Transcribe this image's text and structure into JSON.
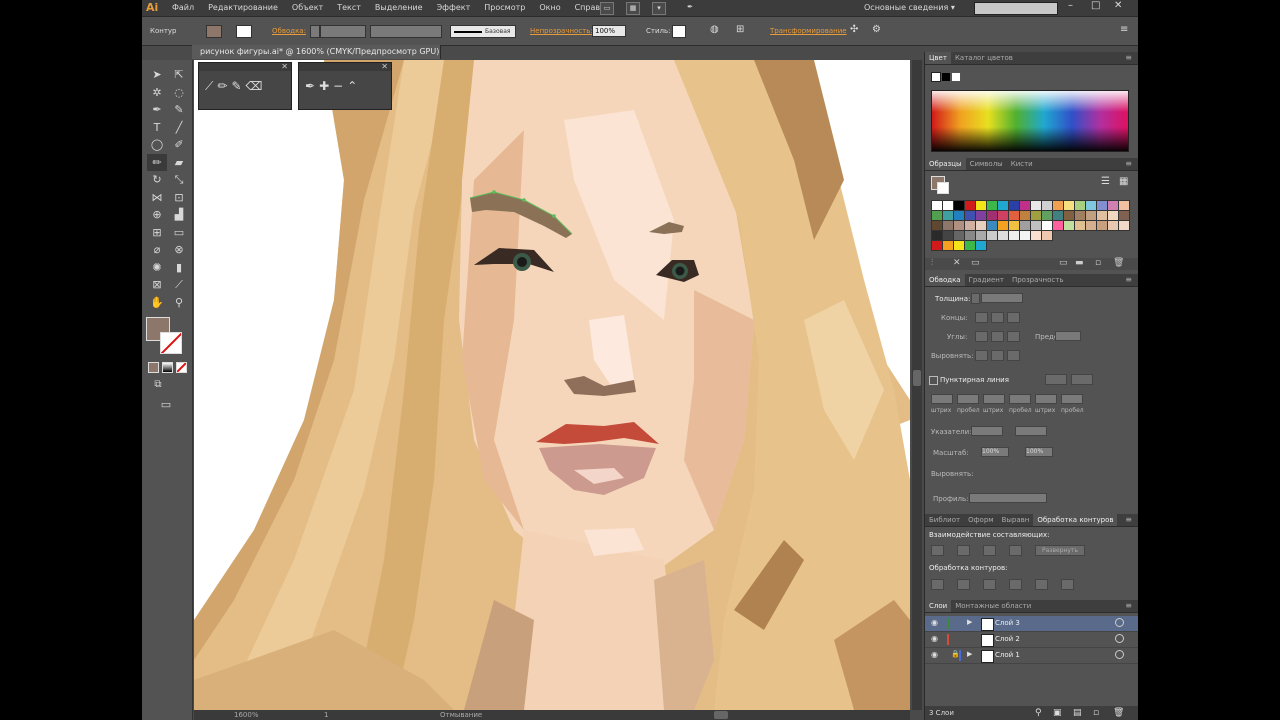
{
  "app": {
    "logo": "Ai",
    "menu": [
      "Файл",
      "Редактирование",
      "Объект",
      "Текст",
      "Выделение",
      "Эффект",
      "Просмотр",
      "Окно",
      "Справка"
    ],
    "workspace": "Основные сведения",
    "accent": "#e79b3a"
  },
  "control": {
    "mode": "Контур",
    "stroke_label": "Обводка:",
    "brush_name": "Базовая",
    "opacity_label": "Непрозрачность:",
    "opacity_value": "100%",
    "style_label": "Стиль:",
    "transform_label": "Трансформирование"
  },
  "document": {
    "tab_title": "рисунок фигуры.ai* @ 1600% (CMYK/Предпросмотр GPU)"
  },
  "toolbar": {
    "fill_color": "#8d776a",
    "stroke_color": "#ffffff"
  },
  "panels": {
    "color_tabs": [
      "Цвет",
      "Каталог цветов"
    ],
    "swatch_tabs": [
      "Образцы",
      "Символы",
      "Кисти"
    ],
    "stroke_tabs": [
      "Обводка",
      "Градиент",
      "Прозрачность"
    ],
    "stroke": {
      "weight_label": "Толщина:",
      "cap_label": "Концы:",
      "corner_label": "Углы:",
      "limit_label": "Предел:",
      "align_label": "Выровнять:",
      "dashed_label": "Пунктирная линия",
      "dash_labels": [
        "штрих",
        "пробел",
        "штрих",
        "пробел",
        "штрих",
        "пробел"
      ],
      "arrow_label": "Указатели:",
      "scale_label": "Масштаб:",
      "scale_1": "100%",
      "scale_2": "100%",
      "align2_label": "Выровнять:",
      "profile_label": "Профиль:"
    },
    "pathfinder_tabs": [
      "Библиот",
      "Оформ",
      "Выравн",
      "Обработка контуров"
    ],
    "pathfinder": {
      "shape_modes": "Взаимодействие составляющих:",
      "expand": "Развернуть",
      "pathfinders": "Обработка контуров:"
    },
    "layers_tabs": [
      "Слои",
      "Монтажные области"
    ],
    "layers": [
      {
        "name": "Слой 3",
        "color": "#3a8a3a",
        "selected": true
      },
      {
        "name": "Слой 2",
        "color": "#d84a3a",
        "selected": false
      },
      {
        "name": "Слой 1",
        "color": "#4a6ad8",
        "selected": false
      }
    ],
    "layers_footer": "3 Слои"
  },
  "status": {
    "zoom": "1600%",
    "page": "1",
    "mode": "Отмывание"
  }
}
